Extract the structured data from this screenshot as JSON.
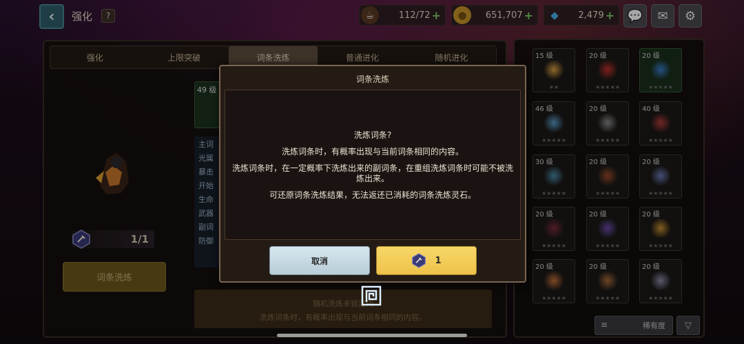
{
  "header": {
    "title": "强化",
    "help": "?",
    "resources": [
      {
        "icon": "coffee-icon",
        "value": "112/72"
      },
      {
        "icon": "gold-coin-icon",
        "value": "651,707"
      },
      {
        "icon": "gem-icon",
        "value": "2,479"
      }
    ]
  },
  "tabs": [
    "强化",
    "上限突破",
    "词条洗炼",
    "普通进化",
    "随机进化"
  ],
  "active_tab": "词条洗炼",
  "left": {
    "stone_count": "1/1",
    "refine_button": "词条洗炼"
  },
  "background_panel": {
    "item_level": "49 级",
    "rows": [
      "主词",
      "光属",
      "暴击",
      "开始",
      "生命",
      "武器",
      "副词",
      "防御"
    ],
    "bottom_line1": "随机洗炼未锁定词",
    "bottom_line2": "洗炼词条时，有概率出现与当前词条相同的内容。"
  },
  "inventory": {
    "slots": [
      {
        "level": "15 级",
        "stars": "★★",
        "green": false,
        "color": "#d9a040"
      },
      {
        "level": "20 级",
        "stars": "★★★★★",
        "green": false,
        "color": "#c0302a"
      },
      {
        "level": "20 级",
        "stars": "★★★★★",
        "green": true,
        "color": "#3a7ac8"
      },
      {
        "level": "46 级",
        "stars": "★★★★★",
        "green": false,
        "color": "#5a9ac8"
      },
      {
        "level": "20 级",
        "stars": "★★★★★",
        "green": false,
        "color": "#8a8a8a"
      },
      {
        "level": "40 级",
        "stars": "★★★★★",
        "green": false,
        "color": "#b03a3a"
      },
      {
        "level": "30 级",
        "stars": "★★★★★",
        "green": false,
        "color": "#4a8aa8"
      },
      {
        "level": "20 级",
        "stars": "★★★★★",
        "green": false,
        "color": "#9a4a2a"
      },
      {
        "level": "20 级",
        "stars": "★★★★★",
        "green": false,
        "color": "#6a7ab8"
      },
      {
        "level": "20 级",
        "stars": "★★★★★",
        "green": false,
        "color": "#7a2a3a"
      },
      {
        "level": "20 级",
        "stars": "★★★★★",
        "green": false,
        "color": "#6a4aa8"
      },
      {
        "level": "20 级",
        "stars": "★★★★★",
        "green": false,
        "color": "#c89030"
      },
      {
        "level": "20 级",
        "stars": "★★★★★",
        "green": false,
        "color": "#c0703a"
      },
      {
        "level": "20 级",
        "stars": "★★★★★",
        "green": false,
        "color": "#a86a3a"
      },
      {
        "level": "20 级",
        "stars": "★★★★★",
        "green": false,
        "color": "#8a8aa8"
      }
    ],
    "sort_label": "稀有度",
    "sort_direction": "▽"
  },
  "dialog": {
    "title": "词条洗炼",
    "question": "洗炼词条?",
    "line1": "洗炼词条时，有概率出现与当前词条相同的内容。",
    "line2": "洗炼词条时，在一定概率下洗炼出来的副词条，在重组洗炼词条时可能不被洗炼出来。",
    "line3": "可还原词条洗炼结果，无法返还已消耗的词条洗炼灵石。",
    "cancel_label": "取消",
    "confirm_cost": "1"
  }
}
